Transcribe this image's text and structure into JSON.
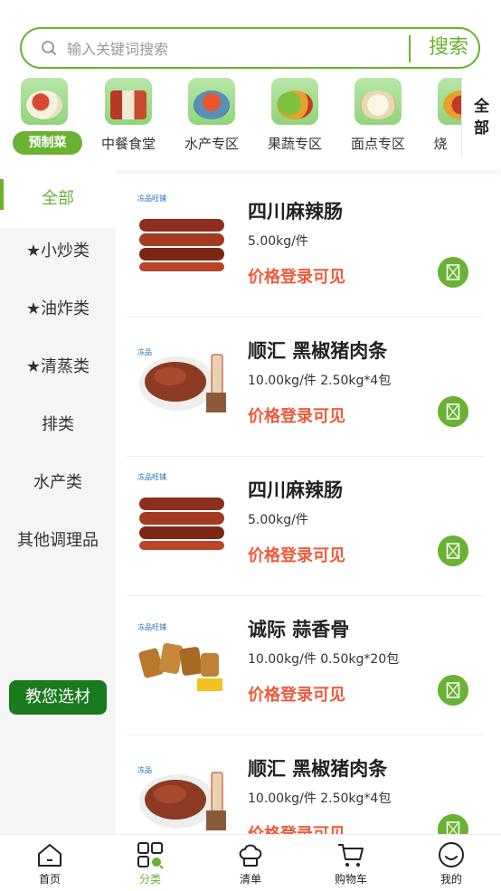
{
  "search": {
    "placeholder": "输入关键词搜索",
    "button": "搜索"
  },
  "categories": {
    "items": [
      {
        "label": "预制菜",
        "icon": "prepared-dish-icon"
      },
      {
        "label": "中餐食堂",
        "icon": "bento-box-icon"
      },
      {
        "label": "水产专区",
        "icon": "seafood-icon"
      },
      {
        "label": "果蔬专区",
        "icon": "vegetables-icon"
      },
      {
        "label": "面点专区",
        "icon": "buns-icon"
      },
      {
        "label": "烧",
        "icon": "grill-icon"
      }
    ],
    "all_label_line1": "全",
    "all_label_line2": "部"
  },
  "sidebar": {
    "items": [
      {
        "label": "全部"
      },
      {
        "label": "★小炒类"
      },
      {
        "label": "★油炸类"
      },
      {
        "label": "★清蒸类"
      },
      {
        "label": "排类"
      },
      {
        "label": "水产类"
      },
      {
        "label": "其他调理品"
      }
    ],
    "guide_button": "教您选材"
  },
  "products": [
    {
      "name": "四川麻辣肠",
      "spec": "5.00kg/件",
      "price": "价格登录可见",
      "image": "sausage-image"
    },
    {
      "name": "顺汇 黑椒猪肉条",
      "spec": "10.00kg/件 2.50kg*4包",
      "price": "价格登录可见",
      "image": "pork-strips-image"
    },
    {
      "name": "四川麻辣肠",
      "spec": "5.00kg/件",
      "price": "价格登录可见",
      "image": "sausage-image"
    },
    {
      "name": "诚际 蒜香骨",
      "spec": "10.00kg/件 0.50kg*20包",
      "price": "价格登录可见",
      "image": "garlic-ribs-image"
    },
    {
      "name": "顺汇 黑椒猪肉条",
      "spec": "10.00kg/件 2.50kg*4包",
      "price": "价格登录可见",
      "image": "pork-strips-image"
    }
  ],
  "tabbar": {
    "items": [
      {
        "label": "首页",
        "icon": "home-icon"
      },
      {
        "label": "分类",
        "icon": "category-icon"
      },
      {
        "label": "清单",
        "icon": "chef-hat-icon"
      },
      {
        "label": "购物车",
        "icon": "cart-icon"
      },
      {
        "label": "我的",
        "icon": "smiley-icon"
      }
    ]
  },
  "colors": {
    "accent": "#6ab232",
    "price": "#f05a3a",
    "guide_button": "#1a7a1e"
  }
}
